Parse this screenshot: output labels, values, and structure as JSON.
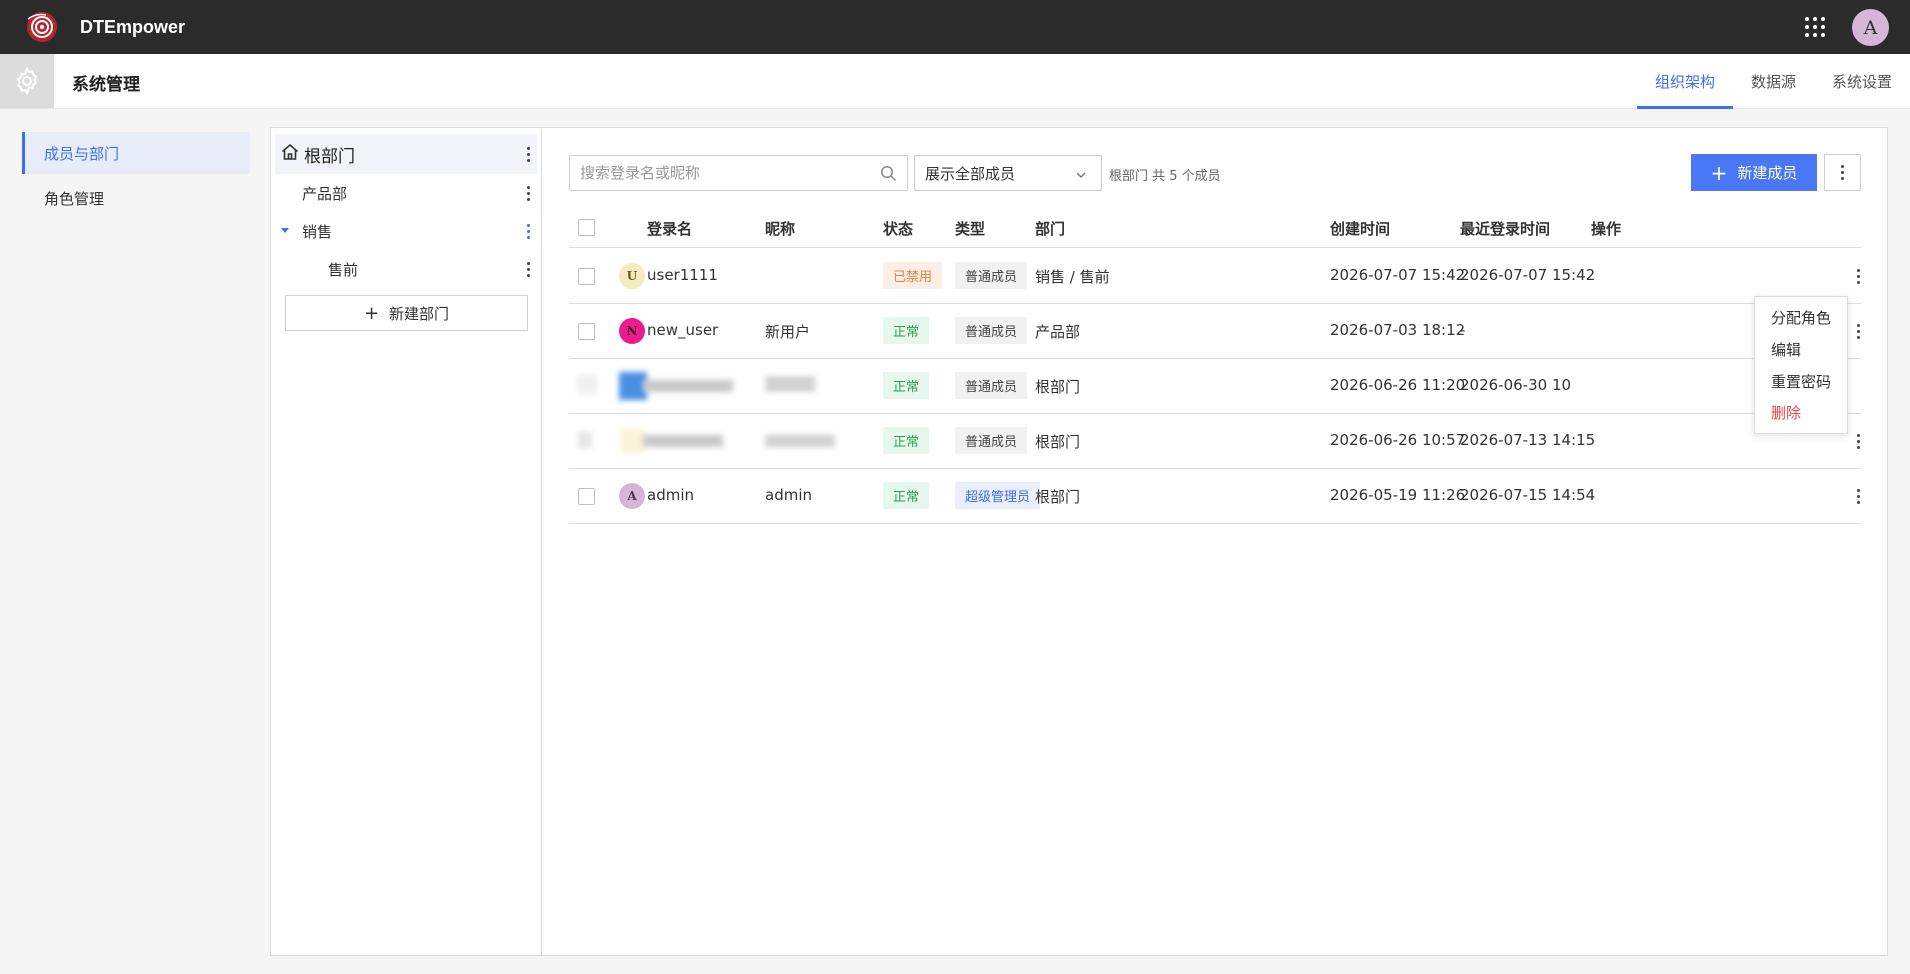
{
  "header": {
    "app_title": "DTEmpower",
    "avatar_letter": "A",
    "icons": {
      "logo": "dtempower-logo",
      "apps": "apps-grid-icon"
    }
  },
  "subheader": {
    "title": "系统管理",
    "tabs": [
      {
        "label": "组织架构",
        "active": true
      },
      {
        "label": "数据源",
        "active": false
      },
      {
        "label": "系统设置",
        "active": false
      }
    ]
  },
  "leftnav": {
    "items": [
      {
        "label": "成员与部门",
        "active": true
      },
      {
        "label": "角色管理",
        "active": false
      }
    ]
  },
  "departments": {
    "root": "根部门",
    "children": [
      {
        "label": "产品部"
      },
      {
        "label": "销售",
        "expanded": true
      },
      {
        "label": "售前"
      }
    ],
    "new_button": "新建部门"
  },
  "toolbar": {
    "search_placeholder": "搜索登录名或昵称",
    "filter_value": "展示全部成员",
    "count_text": "根部门 共 5 个成员",
    "add_button": "新建成员"
  },
  "table": {
    "columns": [
      "登录名",
      "昵称",
      "状态",
      "类型",
      "部门",
      "创建时间",
      "最近登录时间",
      "操作"
    ],
    "rows": [
      {
        "avatar": "U",
        "avatar_color": "#f7e9c0",
        "login": "user1111",
        "nickname": "",
        "status": "已禁用",
        "type": "普通成员",
        "dept": "销售 / 售前",
        "created": "2026-07-07 15:42",
        "last_login": "2026-07-07 15:42"
      },
      {
        "avatar": "N",
        "avatar_color": "#e91e8c",
        "login": "new_user",
        "nickname": "新用户",
        "status": "正常",
        "type": "普通成员",
        "dept": "产品部",
        "created": "2026-07-03 18:12",
        "last_login": "-"
      },
      {
        "avatar": "",
        "avatar_color": "#4a90e2",
        "login": "",
        "nickname": "",
        "status": "正常",
        "type": "普通成员",
        "dept": "根部门",
        "created": "2026-06-26 11:20",
        "last_login": "2026-06-30 10"
      },
      {
        "avatar": "",
        "avatar_color": "#fbf3d5",
        "login": "",
        "nickname": "",
        "status": "正常",
        "type": "普通成员",
        "dept": "根部门",
        "created": "2026-06-26 10:57",
        "last_login": "2026-07-13 14:15"
      },
      {
        "avatar": "A",
        "avatar_color": "#d6b6d6",
        "login": "admin",
        "nickname": "admin",
        "status": "正常",
        "type": "超级管理员",
        "dept": "根部门",
        "created": "2026-05-19 11:26",
        "last_login": "2026-07-15 14:54"
      }
    ]
  },
  "row_menu": {
    "items": [
      {
        "label": "分配角色"
      },
      {
        "label": "编辑"
      },
      {
        "label": "重置密码"
      },
      {
        "label": "删除",
        "danger": true
      }
    ]
  },
  "colors": {
    "accent": "#3d6ff0",
    "button": "#4a78f5",
    "danger": "#e64545"
  }
}
